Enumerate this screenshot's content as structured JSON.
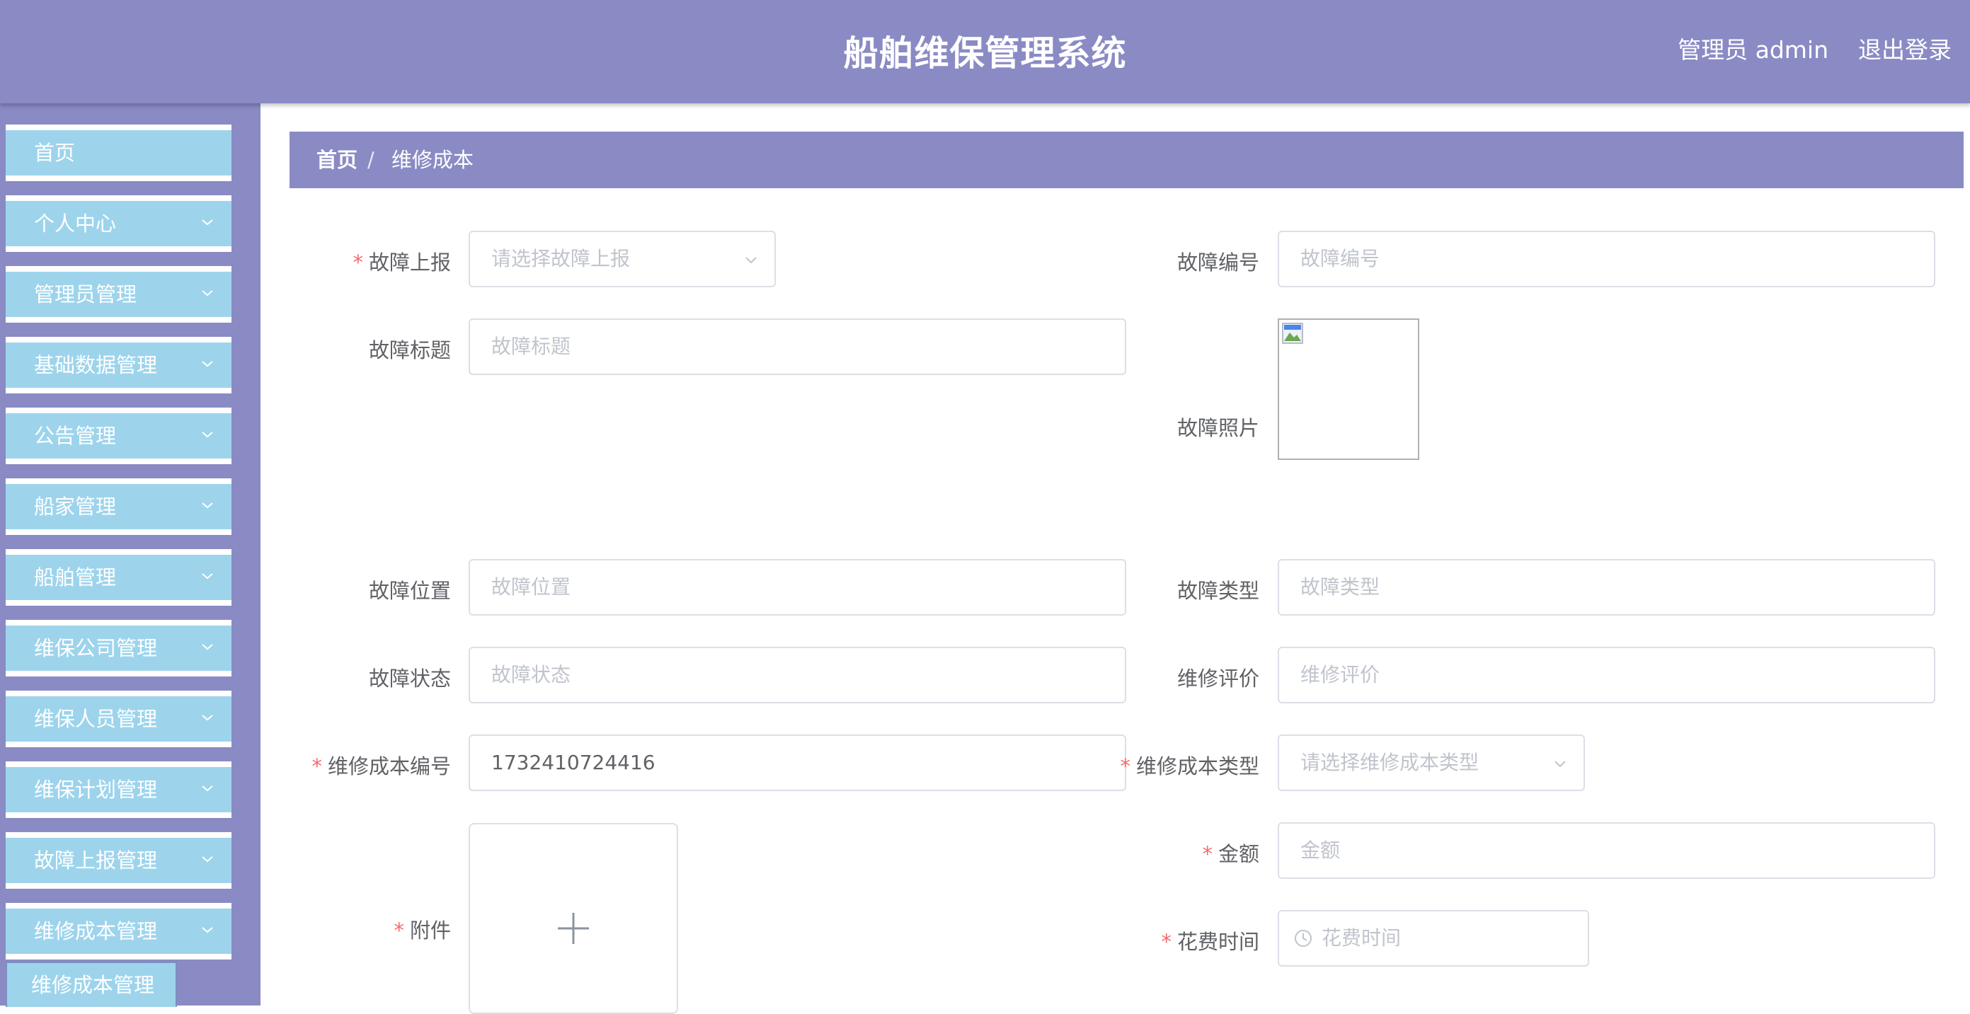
{
  "header": {
    "title": "船舶维保管理系统",
    "user": "管理员 admin",
    "logout": "退出登录"
  },
  "sidebar": {
    "items": [
      {
        "label": "首页"
      },
      {
        "label": "个人中心"
      },
      {
        "label": "管理员管理"
      },
      {
        "label": "基础数据管理"
      },
      {
        "label": "公告管理"
      },
      {
        "label": "船家管理"
      },
      {
        "label": "船舶管理"
      },
      {
        "label": "维保公司管理"
      },
      {
        "label": "维保人员管理"
      },
      {
        "label": "维保计划管理"
      },
      {
        "label": "故障上报管理"
      },
      {
        "label": "维修成本管理"
      }
    ],
    "sub_item": "维修成本管理"
  },
  "breadcrumb": {
    "home": "首页",
    "separator": "/",
    "current": "维修成本"
  },
  "form": {
    "fault_report": {
      "label": "故障上报",
      "placeholder": "请选择故障上报"
    },
    "fault_no": {
      "label": "故障编号",
      "placeholder": "故障编号"
    },
    "fault_title": {
      "label": "故障标题",
      "placeholder": "故障标题"
    },
    "fault_photo": {
      "label": "故障照片"
    },
    "fault_location": {
      "label": "故障位置",
      "placeholder": "故障位置"
    },
    "fault_type": {
      "label": "故障类型",
      "placeholder": "故障类型"
    },
    "fault_status": {
      "label": "故障状态",
      "placeholder": "故障状态"
    },
    "repair_review": {
      "label": "维修评价",
      "placeholder": "维修评价"
    },
    "cost_no": {
      "label": "维修成本编号",
      "value": "1732410724416"
    },
    "cost_type": {
      "label": "维修成本类型",
      "placeholder": "请选择维修成本类型"
    },
    "attachment": {
      "label": "附件"
    },
    "amount": {
      "label": "金额",
      "placeholder": "金额"
    },
    "spend_time": {
      "label": "花费时间",
      "placeholder": "花费时间"
    }
  },
  "colors": {
    "header_bg": "#8a8ac5",
    "menu_bg": "#9dd4ec",
    "required": "#f56c6c"
  }
}
